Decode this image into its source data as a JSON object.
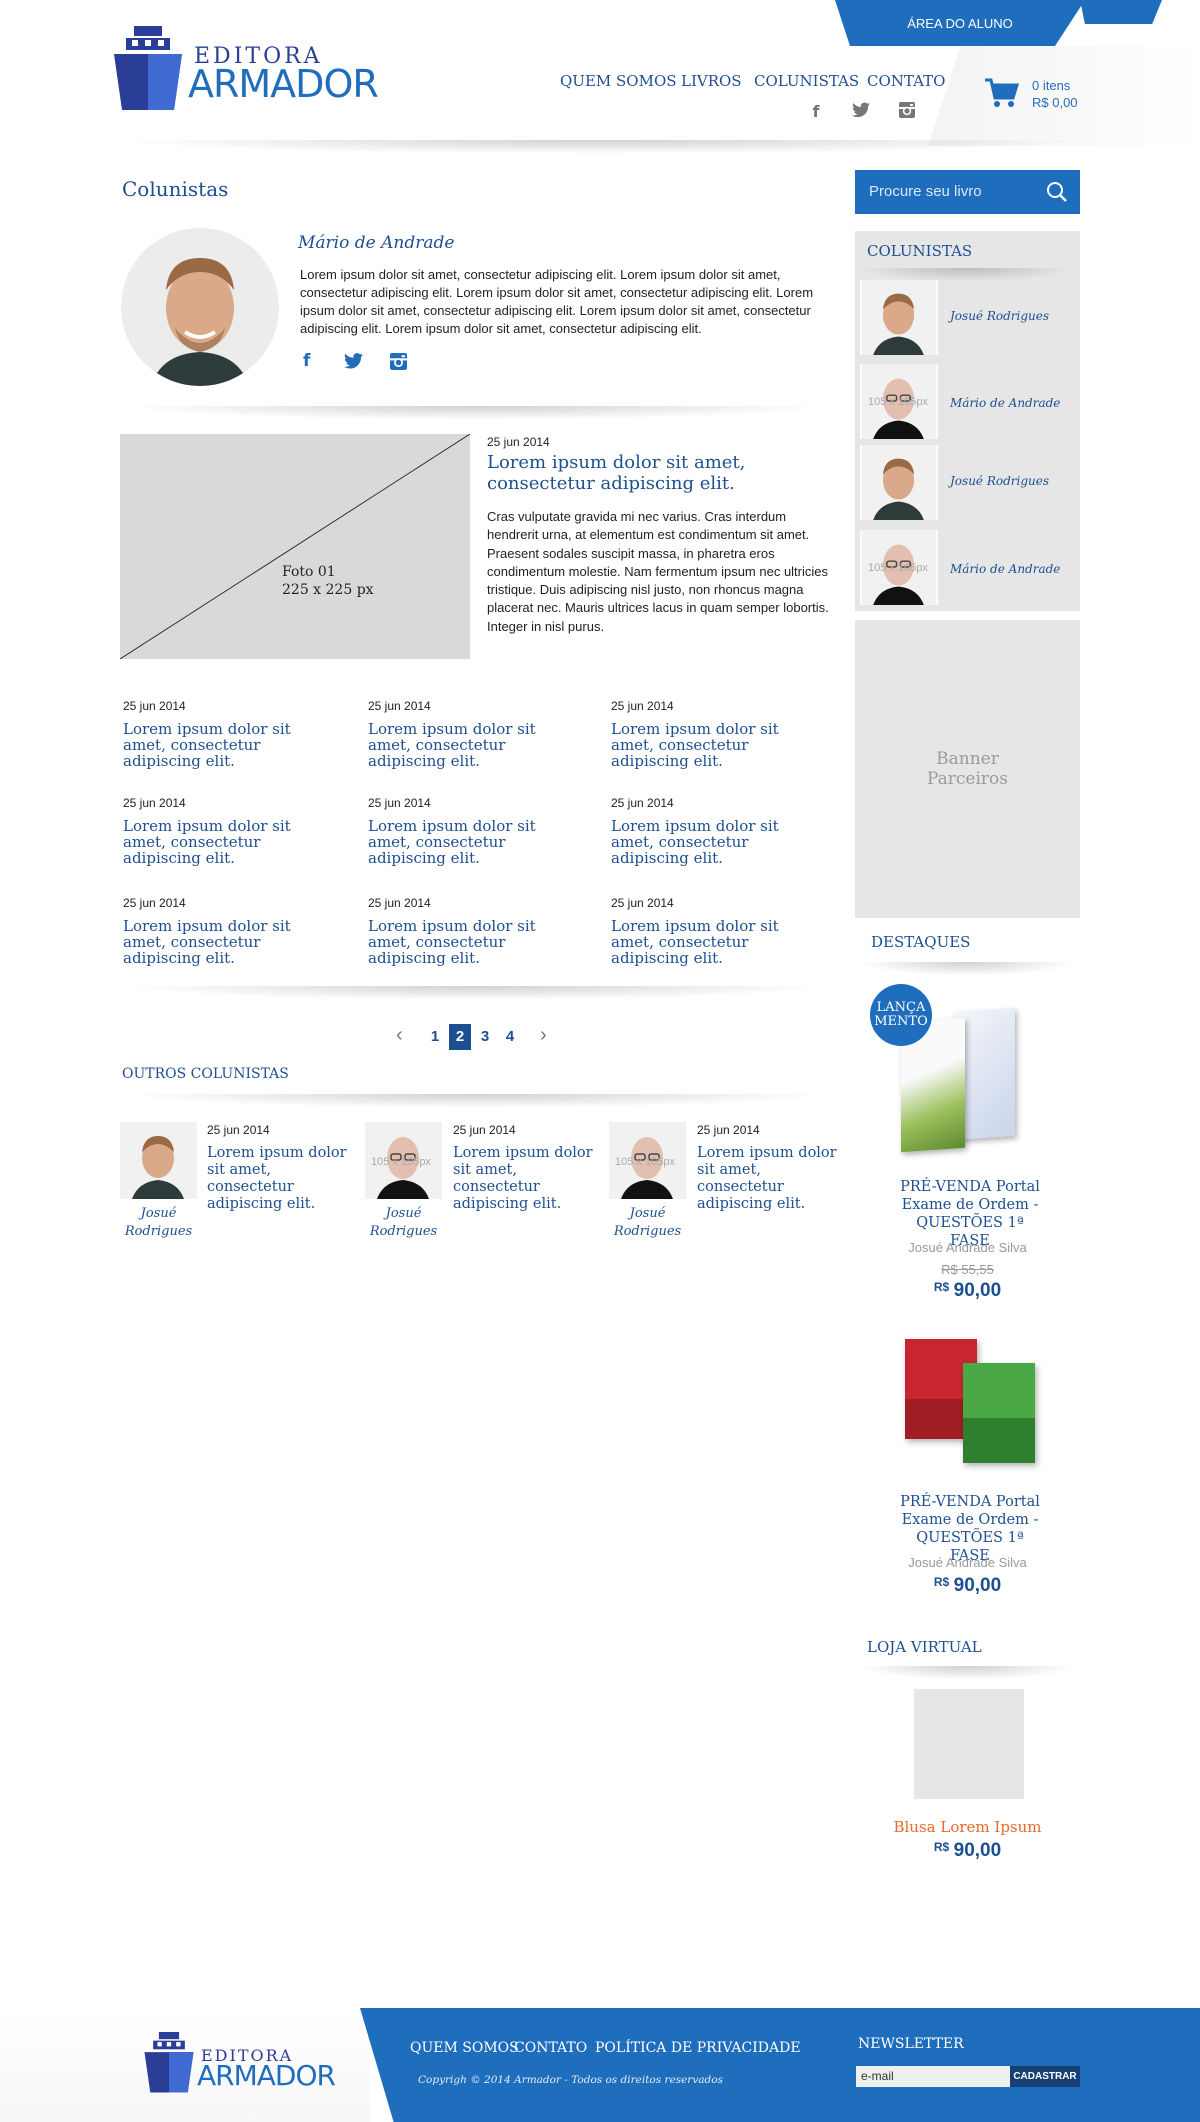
{
  "header": {
    "logo_top": "EDITORA",
    "logo_bottom": "ARMADOR",
    "area_aluno": "ÁREA DO ALUNO",
    "nav": [
      "QUEM SOMOS",
      "LIVROS",
      "COLUNISTAS",
      "CONTATO"
    ],
    "cart_items": "0 itens",
    "cart_total": "R$ 0,00"
  },
  "main": {
    "page_title": "Colunistas",
    "author": {
      "name": "Mário de Andrade",
      "bio": "Lorem ipsum dolor sit amet, consectetur adipiscing elit. Lorem ipsum dolor sit amet, consectetur adipiscing elit. Lorem ipsum dolor sit amet, consectetur adipiscing elit. Lorem ipsum dolor sit amet, consectetur adipiscing elit. Lorem ipsum dolor sit amet, consectetur adipiscing elit. Lorem ipsum dolor sit amet, consectetur adipiscing elit."
    },
    "featured": {
      "photo_label": "Foto 01",
      "photo_size": "225 x 225 px",
      "date": "25 jun 2014",
      "title": "Lorem ipsum dolor sit amet, consectetur adipiscing elit.",
      "body": "Cras vulputate gravida mi nec varius. Cras interdum hendrerit urna, at elementum est condimentum sit amet. Praesent sodales suscipit massa, in pharetra eros condimentum molestie. Nam fermentum ipsum nec ultricies tristique. Duis adipiscing nisl justo, non rhoncus magna placerat nec. Mauris ultrices lacus in quam semper lobortis. Integer in nisl purus."
    },
    "posts": [
      {
        "date": "25 jun 2014",
        "title": "Lorem ipsum dolor sit amet, consectetur adipiscing elit."
      },
      {
        "date": "25 jun 2014",
        "title": "Lorem ipsum dolor sit amet, consectetur adipiscing elit."
      },
      {
        "date": "25 jun 2014",
        "title": "Lorem ipsum dolor sit amet, consectetur adipiscing elit."
      },
      {
        "date": "25 jun 2014",
        "title": "Lorem ipsum dolor sit amet, consectetur adipiscing elit."
      },
      {
        "date": "25 jun 2014",
        "title": "Lorem ipsum dolor sit amet, consectetur adipiscing elit."
      },
      {
        "date": "25 jun 2014",
        "title": "Lorem ipsum dolor sit amet, consectetur adipiscing elit."
      },
      {
        "date": "25 jun 2014",
        "title": "Lorem ipsum dolor sit amet, consectetur adipiscing elit."
      },
      {
        "date": "25 jun 2014",
        "title": "Lorem ipsum dolor sit amet, consectetur adipiscing elit."
      },
      {
        "date": "25 jun 2014",
        "title": "Lorem ipsum dolor sit amet, consectetur adipiscing elit."
      }
    ],
    "pagination": [
      "1",
      "2",
      "3",
      "4"
    ],
    "others_title": "OUTROS COLUNISTAS",
    "others": [
      {
        "date": "25 jun 2014",
        "title": "Lorem ipsum dolor sit amet, consectetur adipiscing elit.",
        "name1": "Josué",
        "name2": "Rodrigues"
      },
      {
        "date": "25 jun 2014",
        "title": "Lorem ipsum dolor sit amet, consectetur adipiscing elit.",
        "name1": "Josué",
        "name2": "Rodrigues",
        "placeholder": "105 x 105px"
      },
      {
        "date": "25 jun 2014",
        "title": "Lorem ipsum dolor sit amet, consectetur adipiscing elit.",
        "name1": "Josué",
        "name2": "Rodrigues",
        "placeholder": "105 x 105px"
      }
    ]
  },
  "sidebar": {
    "search_placeholder": "Procure seu livro",
    "colunistas_title": "COLUNISTAS",
    "colunistas": [
      {
        "name": "Josué Rodrigues"
      },
      {
        "name": "Mário de Andrade",
        "placeholder": "105 x 105px"
      },
      {
        "name": "Josué Rodrigues"
      },
      {
        "name": "Mário de Andrade",
        "placeholder": "105 x 105px"
      }
    ],
    "banner_line1": "Banner",
    "banner_line2": "Parceiros",
    "destaques_title": "DESTAQUES",
    "badge_line1": "LANÇA",
    "badge_line2": "MENTO",
    "books": [
      {
        "title": "PRÉ-VENDA Portal Exame de Ordem - QUESTÕES 1ª FASE",
        "author": "Josué Andrade Silva",
        "old_price": "R$ 55,55",
        "currency": "R$",
        "price": "90,00"
      },
      {
        "title": "PRÉ-VENDA Portal Exame de Ordem - QUESTÕES 1ª FASE",
        "author": "Josué Andrade Silva",
        "currency": "R$",
        "price": "90,00"
      }
    ],
    "loja_title": "LOJA VIRTUAL",
    "product": {
      "title": "Blusa Lorem Ipsum",
      "currency": "R$",
      "price": "90,00"
    }
  },
  "footer": {
    "logo_top": "EDITORA",
    "logo_bottom": "ARMADOR",
    "links": [
      "QUEM SOMOS",
      "CONTATO",
      "POLÍTICA DE PRIVACIDADE"
    ],
    "copyright": "Copyrigh © 2014 Armador - Todos os direitos reservados",
    "newsletter_title": "NEWSLETTER",
    "email_placeholder": "e-mail",
    "subscribe": "CADASTRAR"
  },
  "colors": {
    "primary": "#1f6dbd",
    "dark_blue": "#1d4f91",
    "gray_box": "#e6e6e6",
    "orange": "#e8692a"
  }
}
